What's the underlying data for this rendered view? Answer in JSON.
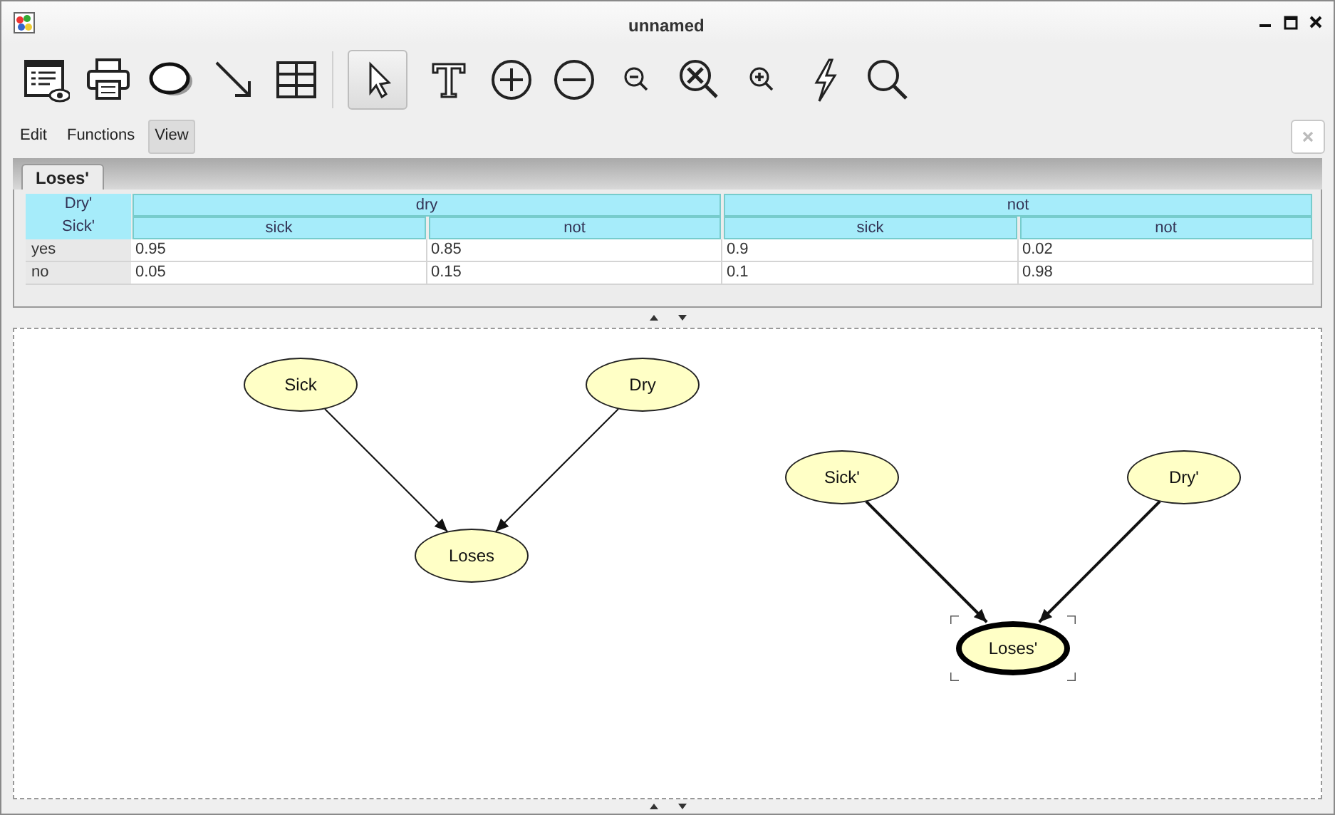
{
  "window": {
    "title": "unnamed"
  },
  "tools": [
    {
      "kind": "preview",
      "selected": false
    },
    {
      "kind": "print",
      "selected": false
    },
    {
      "kind": "node",
      "selected": false
    },
    {
      "kind": "arc",
      "selected": false
    },
    {
      "kind": "table",
      "selected": false
    },
    {
      "kind": "pointer",
      "selected": true
    },
    {
      "kind": "text",
      "selected": false
    },
    {
      "kind": "add",
      "selected": false
    },
    {
      "kind": "remove",
      "selected": false
    },
    {
      "kind": "zoom-out",
      "selected": false
    },
    {
      "kind": "zoom-fit",
      "selected": false
    },
    {
      "kind": "zoom-in",
      "selected": false
    },
    {
      "kind": "lightning",
      "selected": false
    },
    {
      "kind": "search",
      "selected": false
    }
  ],
  "menu": [
    {
      "label": "Edit",
      "selected": false
    },
    {
      "label": "Functions",
      "selected": false
    },
    {
      "label": "View",
      "selected": true
    }
  ],
  "tabs": [
    {
      "label": "Loses'",
      "selected": true
    }
  ],
  "table": {
    "row_headers": [
      "Dry'",
      "Sick'"
    ],
    "header_top": [
      "dry",
      "not"
    ],
    "header_sub": [
      "sick",
      "not",
      "sick",
      "not"
    ],
    "rows": [
      {
        "label": "yes",
        "cells": [
          "0.95",
          "0.85",
          "0.9",
          "0.02"
        ]
      },
      {
        "label": "no",
        "cells": [
          "0.05",
          "0.15",
          "0.1",
          "0.98"
        ]
      }
    ]
  },
  "nodes": [
    {
      "label": "Sick",
      "selected": false
    },
    {
      "label": "Dry",
      "selected": false
    },
    {
      "label": "Loses",
      "selected": false
    },
    {
      "label": "Sick'",
      "selected": false
    },
    {
      "label": "Dry'",
      "selected": false
    },
    {
      "label": "Loses'",
      "selected": true
    }
  ]
}
